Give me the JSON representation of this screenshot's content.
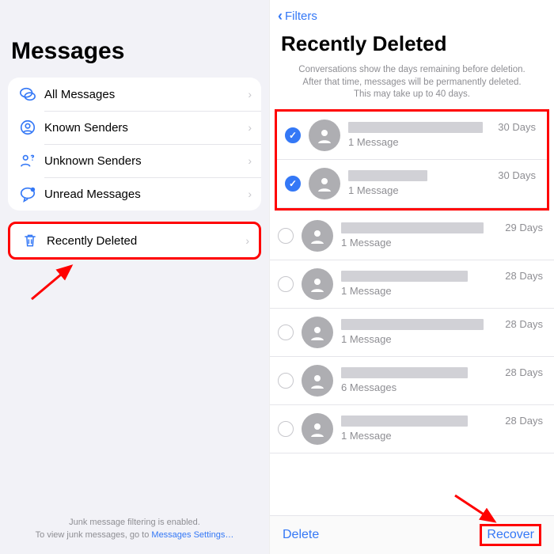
{
  "left": {
    "title": "Messages",
    "filters": [
      {
        "label": "All Messages",
        "icon": "chat-bubbles-icon"
      },
      {
        "label": "Known Senders",
        "icon": "person-circle-icon"
      },
      {
        "label": "Unknown Senders",
        "icon": "person-question-icon"
      },
      {
        "label": "Unread Messages",
        "icon": "chat-dot-icon"
      }
    ],
    "recently_deleted_label": "Recently Deleted",
    "footer_line1": "Junk message filtering is enabled.",
    "footer_line2_a": "To view junk messages, go to ",
    "footer_line2_link": "Messages Settings…"
  },
  "right": {
    "back_label": "Filters",
    "title": "Recently Deleted",
    "info_l1": "Conversations show the days remaining before deletion.",
    "info_l2": "After that time, messages will be permanently deleted.",
    "info_l3": "This may take up to 40 days.",
    "items": [
      {
        "selected": true,
        "name_width": 170,
        "msg": "1 Message",
        "days": "30 Days"
      },
      {
        "selected": true,
        "name_width": 100,
        "msg": "1 Message",
        "days": "30 Days"
      },
      {
        "selected": false,
        "name_width": 180,
        "msg": "1 Message",
        "days": "29 Days"
      },
      {
        "selected": false,
        "name_width": 160,
        "msg": "1 Message",
        "days": "28 Days"
      },
      {
        "selected": false,
        "name_width": 180,
        "msg": "1 Message",
        "days": "28 Days"
      },
      {
        "selected": false,
        "name_width": 160,
        "msg": "6 Messages",
        "days": "28 Days"
      },
      {
        "selected": false,
        "name_width": 160,
        "msg": "1 Message",
        "days": "28 Days"
      }
    ],
    "delete_label": "Delete",
    "recover_label": "Recover"
  }
}
